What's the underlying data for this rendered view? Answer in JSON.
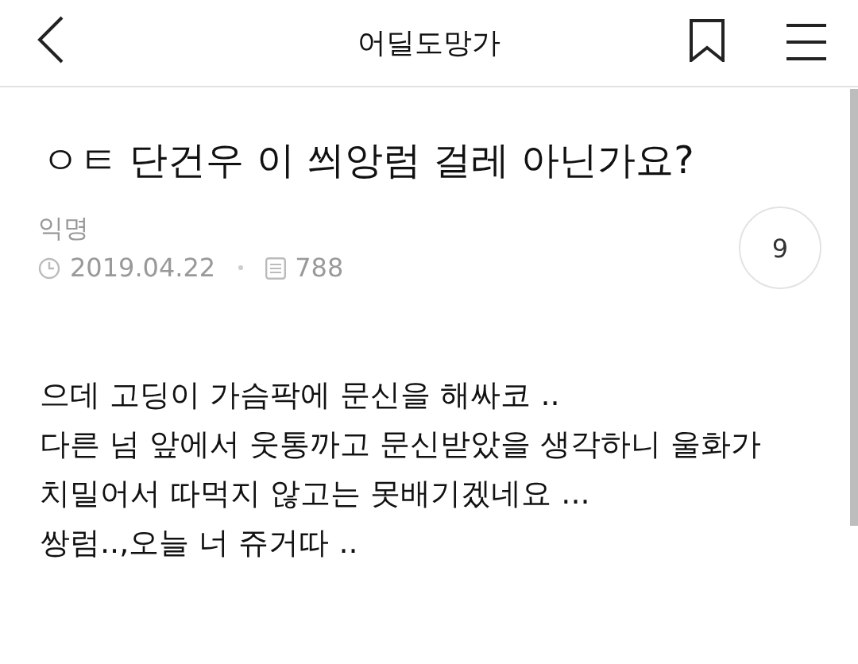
{
  "header": {
    "title": "어딜도망가"
  },
  "post": {
    "title": "ㅇㅌ 단건우 이 씌앙럼 걸레 아닌가요?",
    "author": "익명",
    "date": "2019.04.22",
    "views": "788",
    "comments": "9",
    "body": [
      "으데 고딩이 가슴팍에 문신을 해싸코 ..",
      "다른 넘 앞에서 웃통까고 문신받았을 생각하니 울화가",
      "치밀어서 따먹지 않고는 못배기겠네요 ...",
      "쌍럼..,오늘 너 쥬거따 .."
    ]
  }
}
